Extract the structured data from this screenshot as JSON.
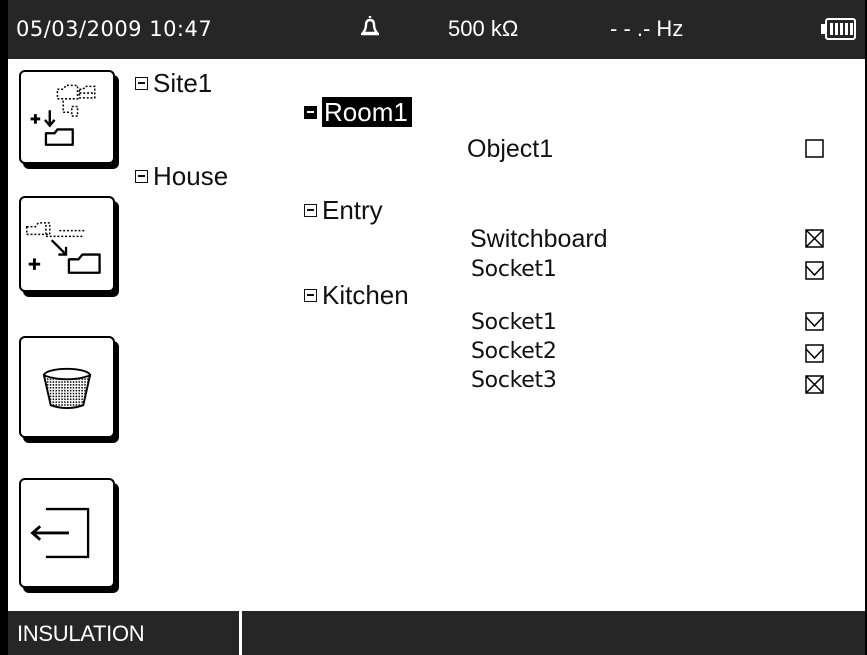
{
  "status_bar": {
    "datetime": "05/03/2009 10:47",
    "bell_icon": "bell-icon",
    "resistance": "500  kΩ",
    "frequency": "- - .-  Hz",
    "battery_icon": "battery-full-icon"
  },
  "toolbar": [
    {
      "name": "add-subfolder-button",
      "icon": "add-subfolder-icon"
    },
    {
      "name": "add-folder-button",
      "icon": "add-folder-icon"
    },
    {
      "name": "delete-button",
      "icon": "trash-icon"
    },
    {
      "name": "exit-button",
      "icon": "exit-arrow-icon"
    }
  ],
  "tree": {
    "sites": [
      {
        "label": "Site1"
      },
      {
        "label": "House"
      }
    ],
    "rooms": [
      {
        "label": "Room1",
        "selected": true
      },
      {
        "label": "Entry"
      },
      {
        "label": "Kitchen"
      }
    ],
    "objects": [
      {
        "label": "Object1",
        "state": "unchecked"
      },
      {
        "label": "Switchboard",
        "state": "crossed"
      },
      {
        "label": "Socket1",
        "state": "checked"
      },
      {
        "label": "Socket1",
        "state": "checked"
      },
      {
        "label": "Socket2",
        "state": "checked"
      },
      {
        "label": "Socket3",
        "state": "crossed"
      }
    ]
  },
  "bottom_bar": {
    "mode": "INSULATION"
  }
}
